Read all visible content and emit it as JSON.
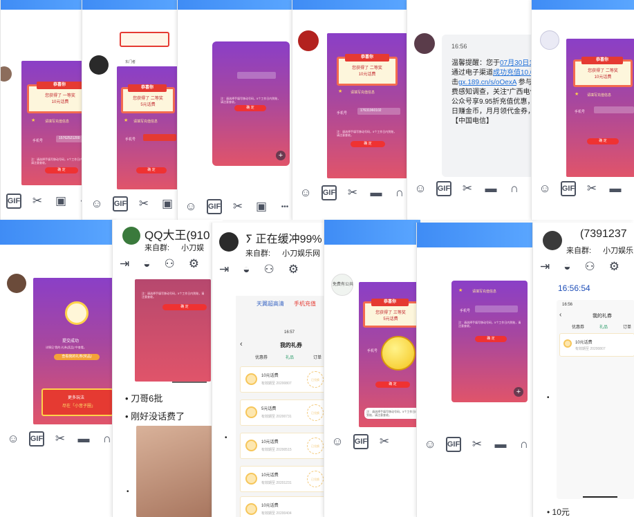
{
  "toolbar": {
    "smile": "☺",
    "gif": "GIF",
    "scissors": "✂",
    "image": "▣",
    "folder": "▬",
    "more": "•••",
    "rich": "∩"
  },
  "prize": {
    "congrats": "恭喜你",
    "won_first": "您获得了 一等奖",
    "won_second": "您获得了 二等奖",
    "won_third": "您获得了 三等奖",
    "fee_10": "10元话费",
    "fee_5": "5元话费",
    "fill_prompt": "请填写充值信息",
    "phone_label": "手机号",
    "confirm": "确 定",
    "note": "注：请选择手填写移动号码，5个工作日内到账，请注意查收。"
  },
  "phones": {
    "p1": "15762521200",
    "p4": "17631960102"
  },
  "chat_sms": {
    "time": "16:56",
    "lines": [
      "温馨提醒：您于",
      "通过电子渠道",
      "击",
      "费感知调查，关注\"广西电信",
      "公众号享9.95折充值优惠，",
      "日赚金币，月月领代金券，抢",
      "【中国电信】"
    ],
    "date_link": "07月30日16",
    "success_link": "成功充值10.0",
    "url_link": "gx.189.cn/s/oOexA",
    "suffix": " 参与"
  },
  "submit": {
    "title": "提交成功",
    "desc": "详情见\"我的-礼券(奖品)\"中查看。",
    "btn": "查看我的礼券(奖品)",
    "banner_a": "更多玩法",
    "banner_b": "尽在「小音子圈」"
  },
  "qq_king": {
    "name": "QQ大王(910",
    "from_label": "来自群:",
    "group": "小刀娱",
    "msg1": "刀哥6批",
    "msg2": "刚好没话费了"
  },
  "buffering": {
    "name": "正在缓冲99%",
    "from_label": "来自群:",
    "group": "小刀娱乐网",
    "tab_a": "天翼超高清",
    "tab_b": "手机充值",
    "status_time": "16:57",
    "page_title": "我的礼券",
    "tabs": [
      "优惠券",
      "礼品",
      "订单"
    ],
    "gifts": [
      {
        "name": "10元话费",
        "exp": "有效期至 20200807"
      },
      {
        "name": "5元话费",
        "exp": "有效期至 20200731"
      },
      {
        "name": "10元话费",
        "exp": "有效期至 20200515"
      },
      {
        "name": "10元话费",
        "exp": "有效期至 20201231"
      },
      {
        "name": "10元话费",
        "exp": "有效期至 20200404"
      }
    ],
    "stamp": "已兑换"
  },
  "last": {
    "name": "(7391237",
    "from_label": "来自群:",
    "group": "小刀娱乐",
    "time": "16:56:54",
    "status_time": "16:56",
    "page_title": "我的礼券",
    "tabs": [
      "优惠券",
      "礼品",
      "订单"
    ],
    "gift_name": "10元话费",
    "gift_exp": "有效期至 20200807",
    "msg": "10元"
  },
  "misc": {
    "public_label": "免费有公共",
    "sender": "东门者"
  },
  "colors": {
    "accent": "#3f8cf5",
    "link": "#1f6fd8",
    "prize_red": "#e53a32"
  }
}
